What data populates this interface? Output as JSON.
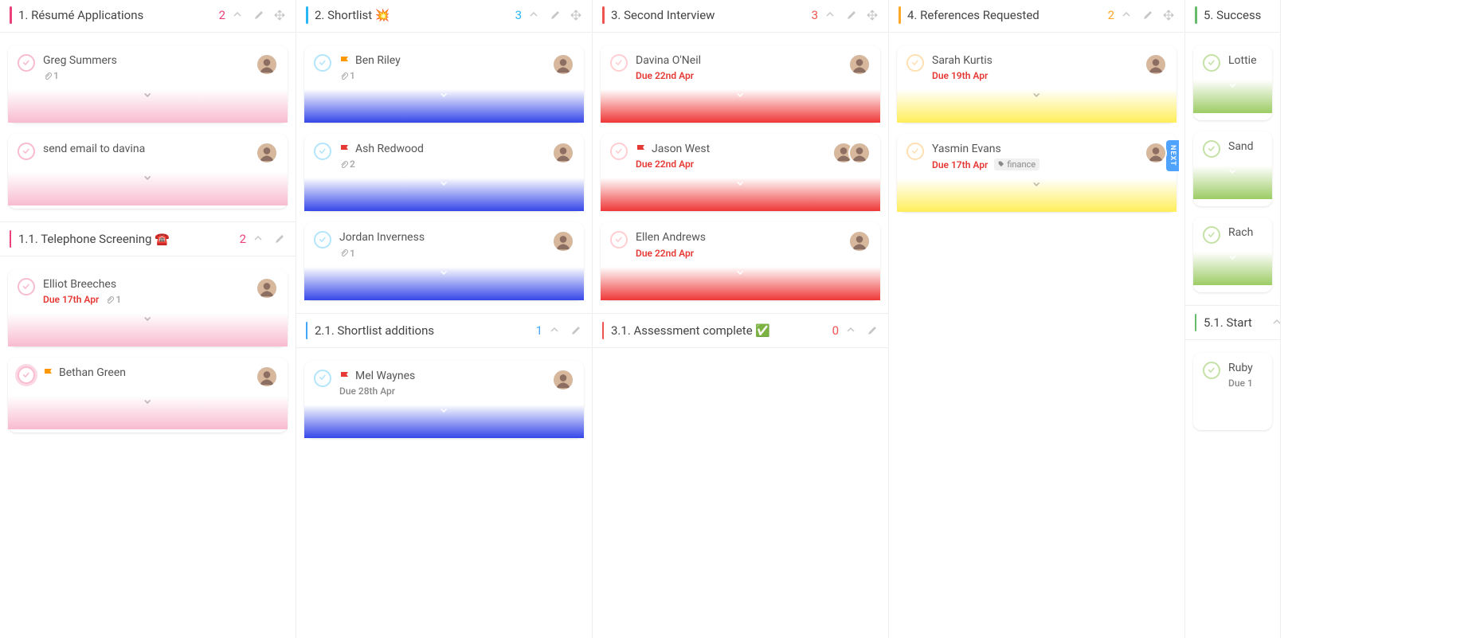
{
  "columns": [
    {
      "title": "1. Résumé Applications",
      "count": "2",
      "accent": "pink",
      "cards": [
        {
          "title": "Greg Summers",
          "ring": "pink",
          "grad": "pink",
          "attachments": "1",
          "avatars": 1,
          "chev": "dark"
        },
        {
          "title": "send email to davina",
          "ring": "pink",
          "grad": "pink",
          "avatars": 1,
          "chev": "dark"
        }
      ],
      "sub": {
        "title": "1.1. Telephone Screening ☎️",
        "count": "2",
        "accent": "pink",
        "cards": [
          {
            "title": "Elliot Breeches",
            "ring": "pink",
            "grad": "pink",
            "due": "Due 17th Apr",
            "dueClass": "due-red",
            "attachments": "1",
            "avatars": 1,
            "chev": "dark"
          },
          {
            "title": "Bethan Green",
            "ring": "pink",
            "grad": "pink",
            "flag": "orange",
            "avatars": 1,
            "chev": "dark",
            "ringGlow": true
          }
        ]
      }
    },
    {
      "title": "2. Shortlist 💥",
      "count": "3",
      "accent": "cyan",
      "cards": [
        {
          "title": "Ben Riley",
          "ring": "cyan",
          "grad": "blue",
          "flag": "orange",
          "attachments": "1",
          "avatars": 1
        },
        {
          "title": "Ash Redwood",
          "ring": "cyan",
          "grad": "blue",
          "flag": "red",
          "attachments": "2",
          "avatars": 1
        },
        {
          "title": "Jordan Inverness",
          "ring": "cyan",
          "grad": "blue",
          "attachments": "1",
          "avatars": 1
        }
      ],
      "sub": {
        "title": "2.1. Shortlist additions",
        "count": "1",
        "accent": "blue",
        "cards": [
          {
            "title": "Mel Waynes",
            "ring": "cyan",
            "grad": "blue",
            "flag": "red",
            "due": "Due 28th Apr",
            "dueClass": "due-gray",
            "avatars": 1
          }
        ]
      }
    },
    {
      "title": "3. Second Interview",
      "count": "3",
      "accent": "red",
      "cards": [
        {
          "title": "Davina O'Neil",
          "ring": "red",
          "grad": "red",
          "due": "Due 22nd Apr",
          "dueClass": "due-red",
          "avatars": 1
        },
        {
          "title": "Jason West",
          "ring": "red",
          "grad": "red",
          "flag": "red",
          "due": "Due 22nd Apr",
          "dueClass": "due-red",
          "avatars": 2,
          "ringProgress": true
        },
        {
          "title": "Ellen Andrews",
          "ring": "red",
          "grad": "red",
          "due": "Due 22nd Apr",
          "dueClass": "due-red",
          "avatars": 1
        }
      ],
      "sub": {
        "title": "3.1. Assessment complete ✅",
        "count": "0",
        "accent": "red",
        "cards": []
      }
    },
    {
      "title": "4. References Requested",
      "count": "2",
      "accent": "orange",
      "cards": [
        {
          "title": "Sarah Kurtis",
          "ring": "orange",
          "grad": "yellow",
          "due": "Due 19th Apr",
          "dueClass": "due-red",
          "avatars": 1,
          "chev": "dark"
        },
        {
          "title": "Yasmin Evans",
          "ring": "orange",
          "grad": "yellow",
          "due": "Due 17th Apr",
          "dueClass": "due-red",
          "tag": "finance",
          "avatars": 1,
          "chev": "dark",
          "nextTab": "NEXT"
        }
      ]
    },
    {
      "title": "5. Success",
      "count": "",
      "accent": "green",
      "partial": true,
      "cards": [
        {
          "title": "Lottie",
          "ring": "green",
          "grad": "green"
        },
        {
          "title": "Sand",
          "ring": "green",
          "grad": "green"
        },
        {
          "title": "Rach",
          "ring": "green",
          "grad": "green"
        }
      ],
      "sub": {
        "title": "5.1. Start",
        "count": "",
        "accent": "green",
        "cards": [
          {
            "title": "Ruby",
            "ring": "green",
            "grad": "",
            "due": "Due 1",
            "dueClass": "due-gray"
          }
        ]
      }
    }
  ]
}
